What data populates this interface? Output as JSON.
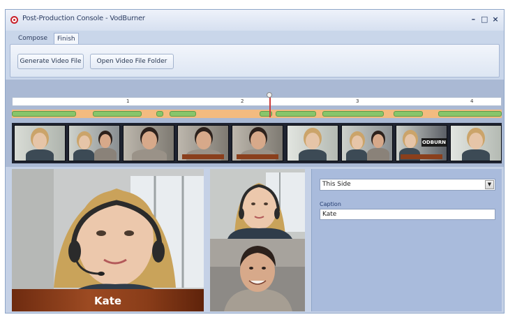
{
  "window": {
    "title": "Post-Production Console - VodBurner",
    "controls": {
      "minimize": "–",
      "maximize": "□",
      "close": "×"
    }
  },
  "tabs": [
    {
      "label": "Compose",
      "active": false
    },
    {
      "label": "Finish",
      "active": true
    }
  ],
  "ribbon": {
    "buttons": [
      {
        "label": "Generate Video File"
      },
      {
        "label": "Open Video File Folder"
      }
    ]
  },
  "timeline": {
    "ruler_marks": [
      "1",
      "2",
      "3",
      "4"
    ]
  },
  "thumbnails": [
    {
      "subject": "woman"
    },
    {
      "subject": "both"
    },
    {
      "subject": "man"
    },
    {
      "subject": "man"
    },
    {
      "subject": "man"
    },
    {
      "subject": "woman"
    },
    {
      "subject": "both"
    },
    {
      "subject": "both",
      "overlay_text": "ODBURN"
    },
    {
      "subject": "woman"
    }
  ],
  "preview": {
    "caption": "Kate"
  },
  "side_panel": {
    "layout_select": "This Side",
    "caption_label": "Caption",
    "caption_value": "Kate"
  },
  "colors": {
    "accent_segments": "#88c56a",
    "timeline_gap": "#f3bb80",
    "caption_band": "#8a3f1c",
    "panel_bg": "#a9bbdc"
  }
}
